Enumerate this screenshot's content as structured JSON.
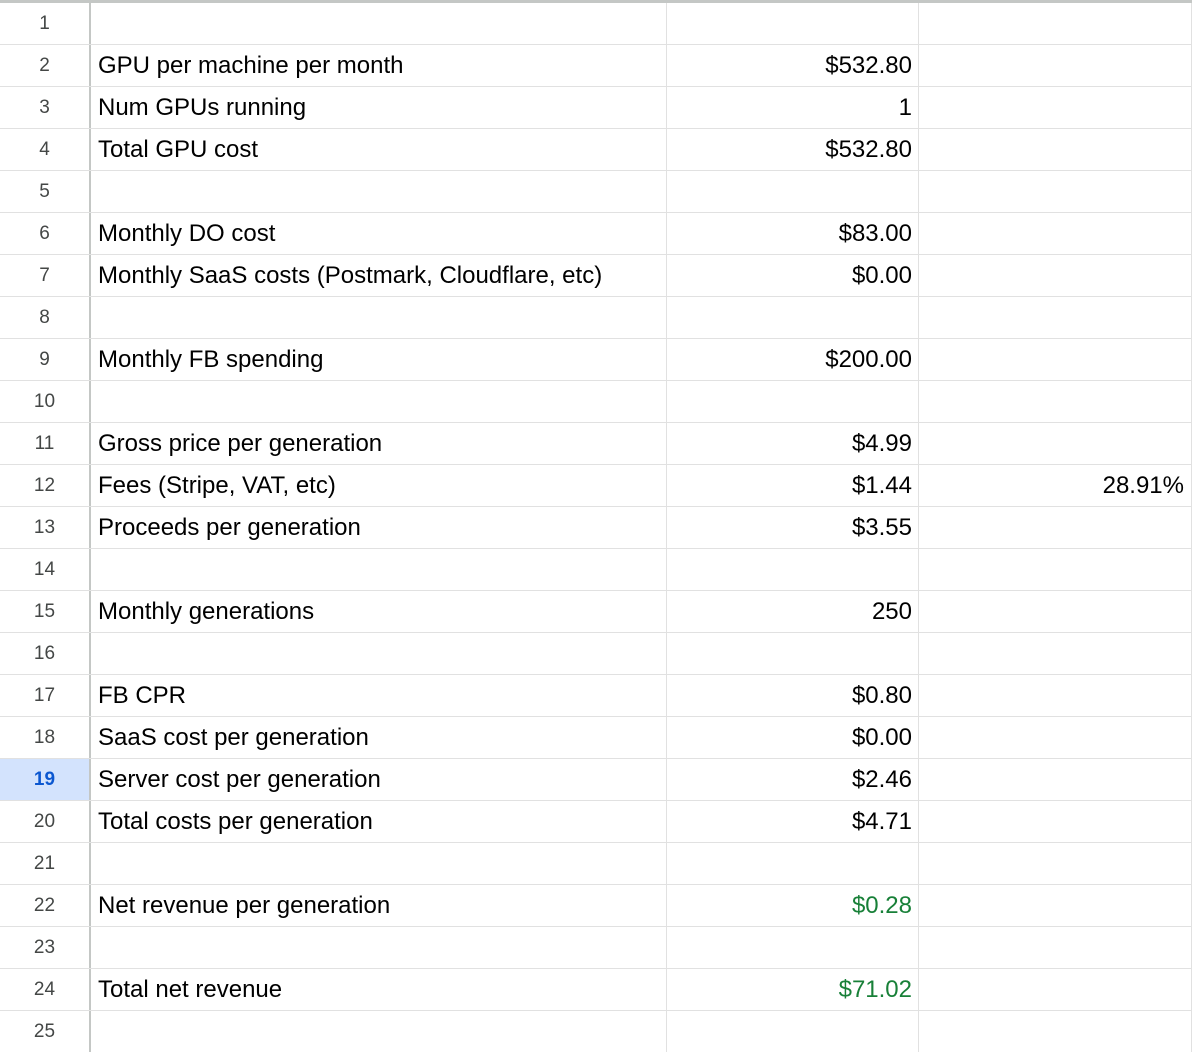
{
  "accent_green": "#188038",
  "selected_row": "19",
  "rows": [
    {
      "num": "1",
      "label": "",
      "value": "",
      "extra": ""
    },
    {
      "num": "2",
      "label": "GPU per machine per month",
      "value": "$532.80",
      "extra": ""
    },
    {
      "num": "3",
      "label": "Num GPUs running",
      "value": "1",
      "extra": ""
    },
    {
      "num": "4",
      "label": "Total GPU cost",
      "value": "$532.80",
      "extra": ""
    },
    {
      "num": "5",
      "label": "",
      "value": "",
      "extra": ""
    },
    {
      "num": "6",
      "label": "Monthly DO cost",
      "value": "$83.00",
      "extra": ""
    },
    {
      "num": "7",
      "label": "Monthly SaaS costs (Postmark, Cloudflare, etc)",
      "value": "$0.00",
      "extra": ""
    },
    {
      "num": "8",
      "label": "",
      "value": "",
      "extra": ""
    },
    {
      "num": "9",
      "label": "Monthly FB spending",
      "value": "$200.00",
      "extra": ""
    },
    {
      "num": "10",
      "label": "",
      "value": "",
      "extra": ""
    },
    {
      "num": "11",
      "label": "Gross price per generation",
      "value": "$4.99",
      "extra": ""
    },
    {
      "num": "12",
      "label": "Fees (Stripe, VAT, etc)",
      "value": "$1.44",
      "extra": "28.91%"
    },
    {
      "num": "13",
      "label": "Proceeds per generation",
      "value": "$3.55",
      "extra": ""
    },
    {
      "num": "14",
      "label": "",
      "value": "",
      "extra": ""
    },
    {
      "num": "15",
      "label": "Monthly generations",
      "value": "250",
      "extra": ""
    },
    {
      "num": "16",
      "label": "",
      "value": "",
      "extra": ""
    },
    {
      "num": "17",
      "label": "FB CPR",
      "value": "$0.80",
      "extra": ""
    },
    {
      "num": "18",
      "label": "SaaS cost per generation",
      "value": "$0.00",
      "extra": ""
    },
    {
      "num": "19",
      "label": "Server cost per generation",
      "value": "$2.46",
      "extra": ""
    },
    {
      "num": "20",
      "label": "Total costs per generation",
      "value": "$4.71",
      "extra": ""
    },
    {
      "num": "21",
      "label": "",
      "value": "",
      "extra": ""
    },
    {
      "num": "22",
      "label": "Net revenue per generation",
      "value": "$0.28",
      "extra": "",
      "value_color": "green"
    },
    {
      "num": "23",
      "label": "",
      "value": "",
      "extra": ""
    },
    {
      "num": "24",
      "label": "Total net revenue",
      "value": "$71.02",
      "extra": "",
      "value_color": "green"
    },
    {
      "num": "25",
      "label": "",
      "value": "",
      "extra": ""
    }
  ]
}
